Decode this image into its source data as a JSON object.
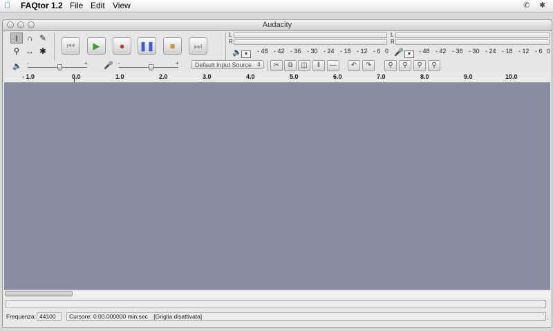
{
  "menubar": {
    "app_name": "FAQtor 1.2",
    "items": [
      "File",
      "Edit",
      "View"
    ]
  },
  "window": {
    "title": "Audacity"
  },
  "tools": {
    "icons": [
      "ibeam-select-icon",
      "envelope-icon",
      "pencil-draw-icon",
      "zoom-icon",
      "timeshift-icon",
      "multi-tool-icon"
    ]
  },
  "transport": {
    "buttons": [
      "skip-start",
      "play",
      "record",
      "pause",
      "stop",
      "skip-end"
    ]
  },
  "meters": {
    "play_scale": [
      "- 48",
      "- 42",
      "- 36",
      "- 30",
      "- 24",
      "- 18",
      "- 12",
      "- 6",
      "0"
    ],
    "record_scale": [
      "- 48",
      "- 42",
      "- 36",
      "- 30",
      "- 24",
      "- 18",
      "- 12",
      "- 6",
      "0"
    ],
    "channel_left": "L",
    "channel_right": "R"
  },
  "mixer": {
    "output_minus": "-",
    "output_plus": "+",
    "input_minus": "-",
    "input_plus": "+",
    "output_volume": 0.55,
    "input_volume": 0.55,
    "input_source": "Default Input Source"
  },
  "ruler": {
    "ticks": [
      "- 1.0",
      "0.0",
      "1.0",
      "2.0",
      "3.0",
      "4.0",
      "5.0",
      "6.0",
      "7.0",
      "8.0",
      "9.0",
      "10.0"
    ]
  },
  "statusbar": {
    "rate_label": "Frequenza:",
    "rate_value": "44100",
    "cursor_text": "Cursore: 0:00.000000 min:sec",
    "snap_text": "[Griglia disattivata]"
  },
  "colors": {
    "track_area": "#8b8ba1",
    "play_green": "#3a9a2c",
    "record_red": "#c8302a",
    "pause_blue": "#3a59d4",
    "stop_orange": "#c99a3a"
  }
}
